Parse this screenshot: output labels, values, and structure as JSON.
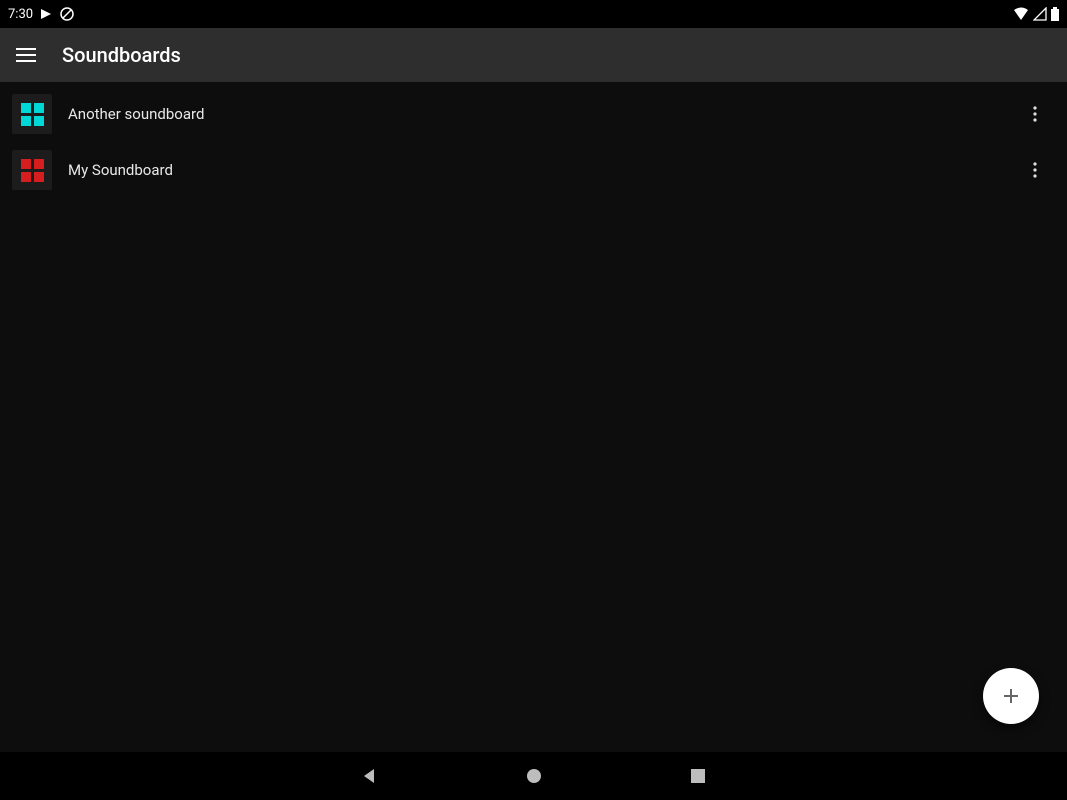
{
  "status": {
    "time": "7:30"
  },
  "header": {
    "title": "Soundboards"
  },
  "soundboards": [
    {
      "label": "Another soundboard",
      "color": "#00d7d7"
    },
    {
      "label": "My Soundboard",
      "color": "#d71e1e"
    }
  ]
}
